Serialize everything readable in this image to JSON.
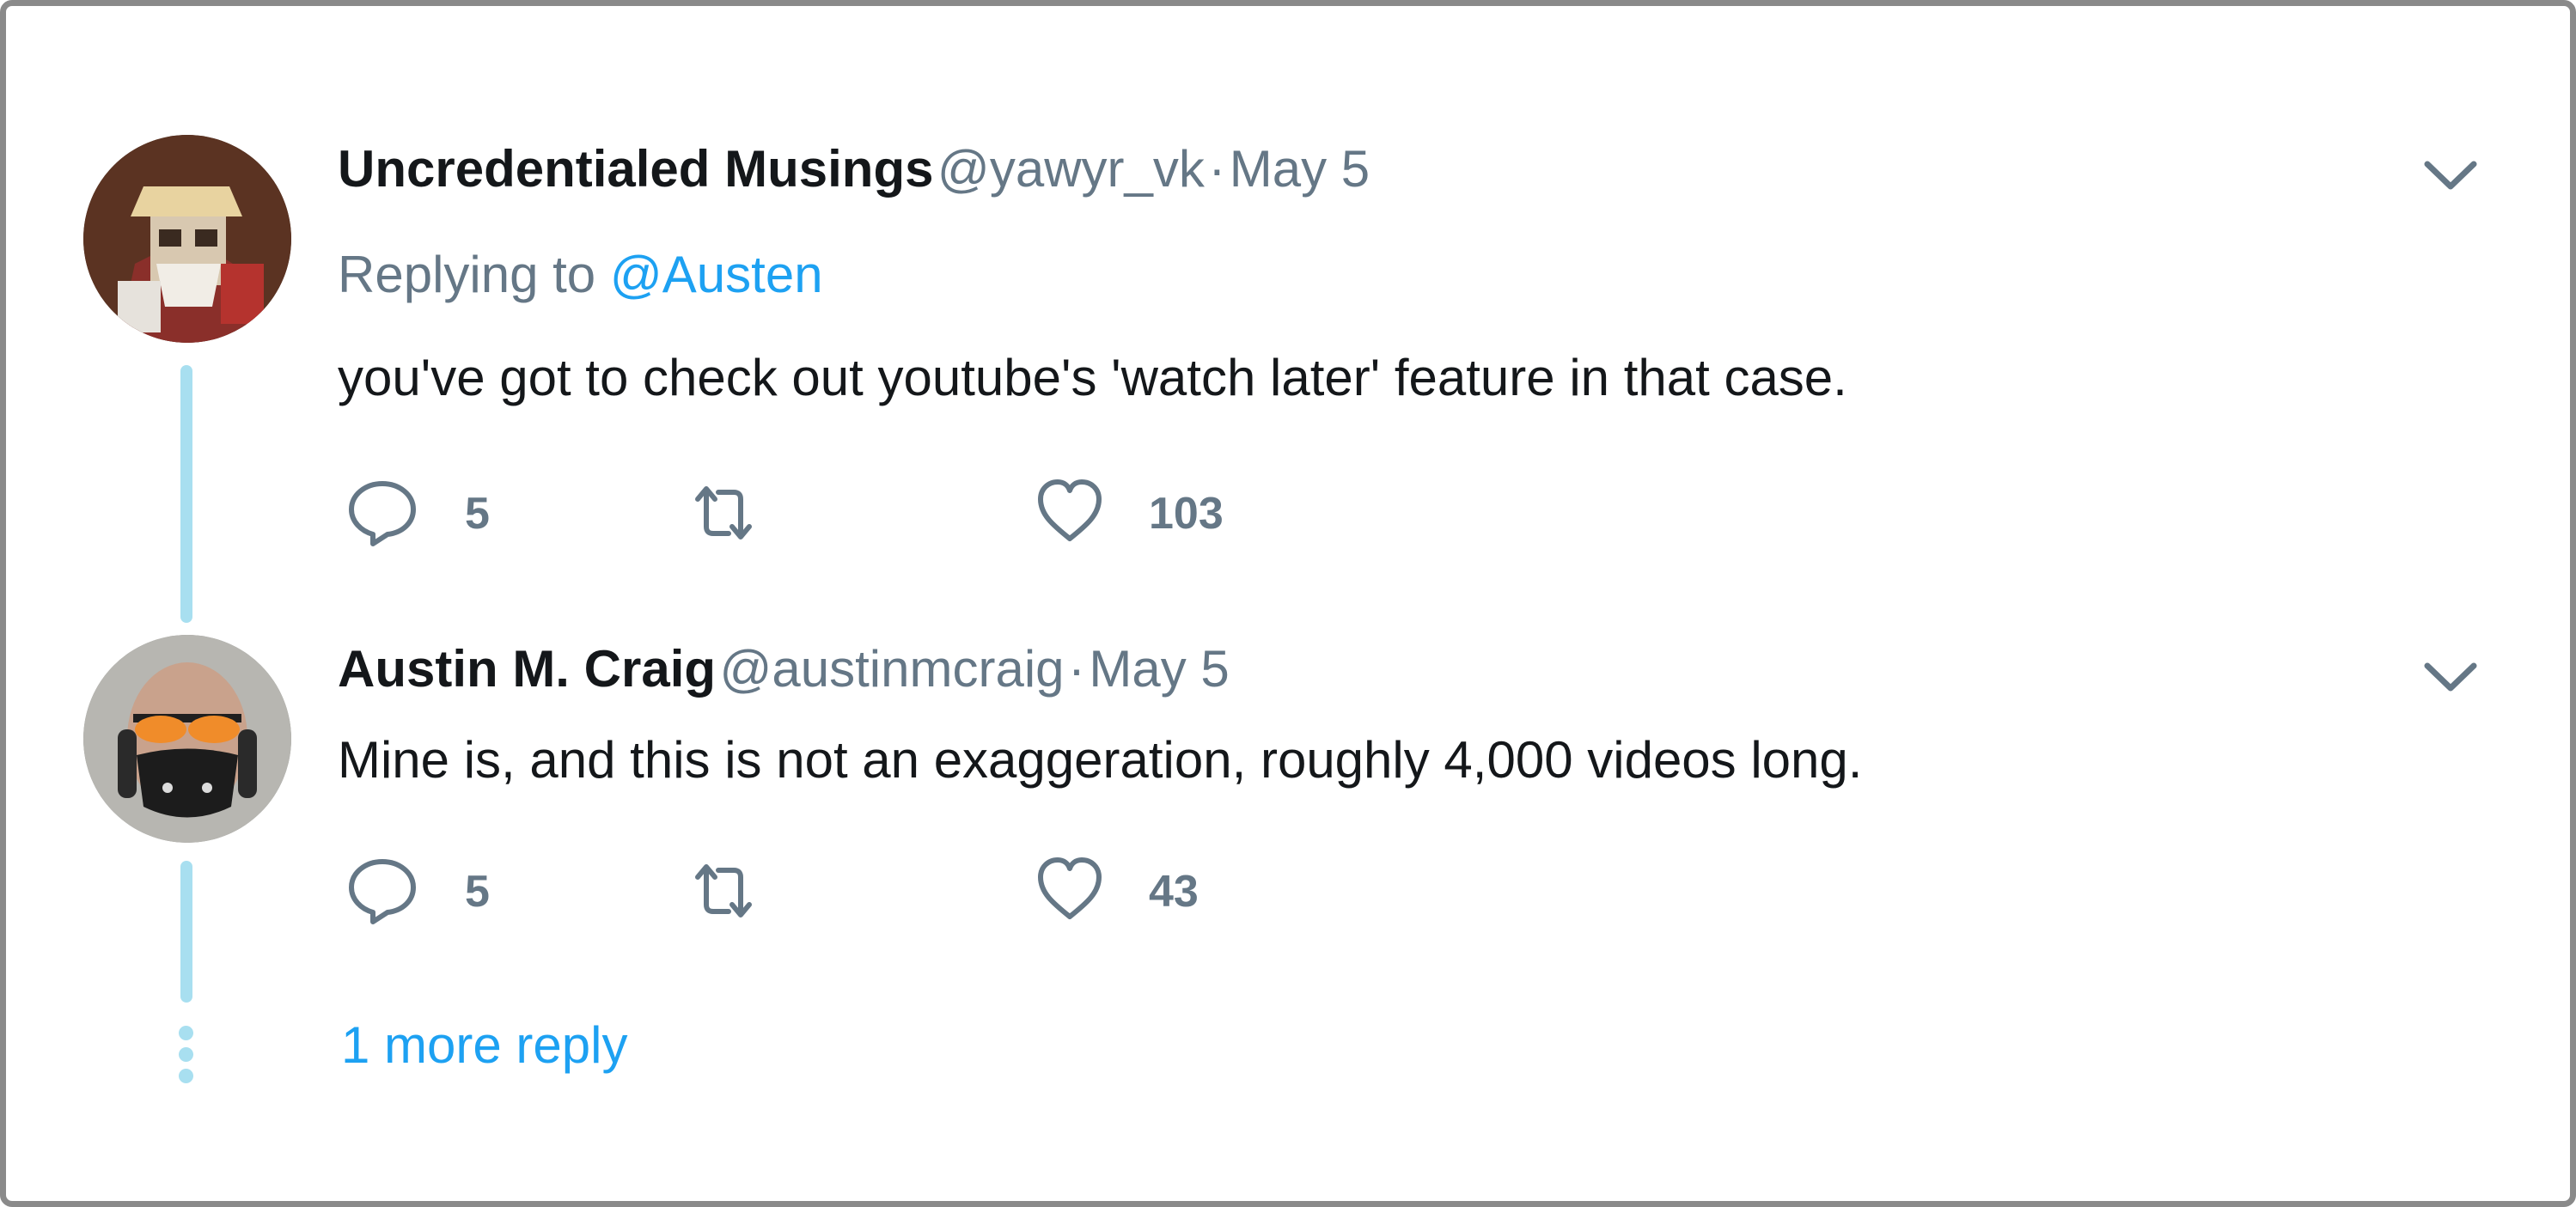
{
  "tweets": [
    {
      "display_name": "Uncredentialed Musings",
      "handle": "@yawyr_vk",
      "separator": "·",
      "date": "May 5",
      "replying_prefix": "Replying to",
      "replying_to": "@Austen",
      "text": "you've got to check out youtube's 'watch later' feature in that case.",
      "reply_count": "5",
      "like_count": "103",
      "icons": {
        "reply": "reply-icon",
        "retweet": "retweet-icon",
        "like": "heart-icon",
        "menu": "chevron-down-icon"
      }
    },
    {
      "display_name": "Austin M. Craig",
      "handle": "@austinmcraig",
      "separator": "·",
      "date": "May 5",
      "text": "Mine is, and this is not an exaggeration, roughly 4,000 videos long.",
      "reply_count": "5",
      "like_count": "43",
      "icons": {
        "reply": "reply-icon",
        "retweet": "retweet-icon",
        "like": "heart-icon",
        "menu": "chevron-down-icon"
      }
    }
  ],
  "more_replies": "1 more reply",
  "colors": {
    "link": "#1da1f2",
    "name": "#14171a",
    "secondary": "#657786",
    "thread_line": "#a8dff0",
    "frame_border": "#8a8a8a"
  }
}
